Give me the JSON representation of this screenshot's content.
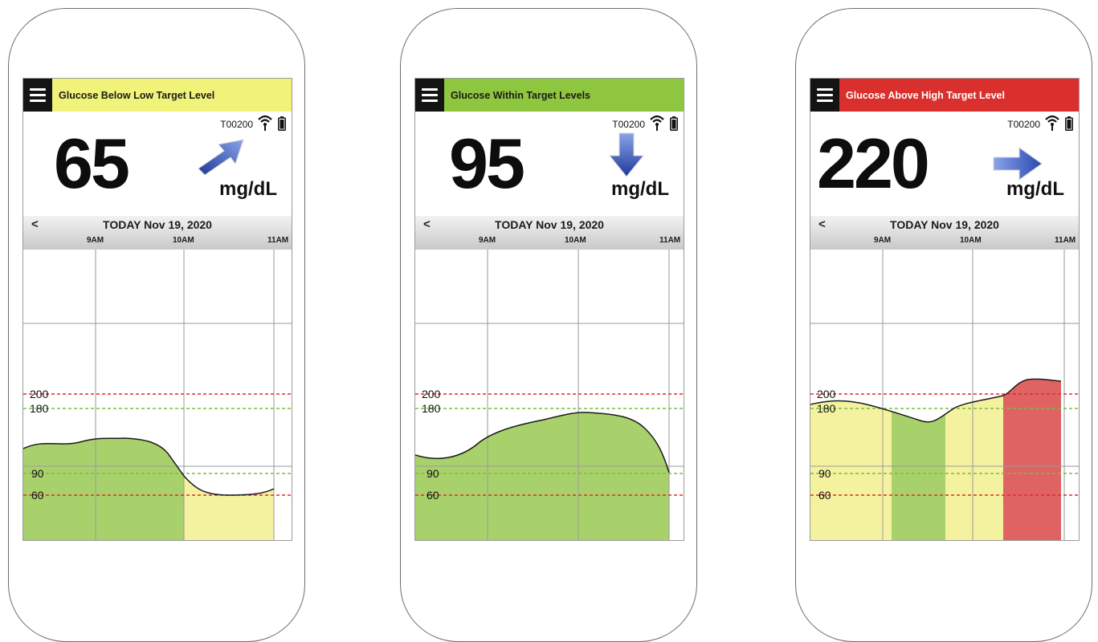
{
  "screens": [
    {
      "status_text": "Glucose Below Low Target Level",
      "status_color": "#f0f27a",
      "device_id": "T00200",
      "reading": "65",
      "unit": "mg/dL",
      "trend": "rising-arrow",
      "date": "TODAY Nov 19, 2020",
      "prev_label": "<",
      "times": [
        "9AM",
        "10AM",
        "11AM"
      ],
      "threshold_labels": [
        "200",
        "180",
        "90",
        "60"
      ]
    },
    {
      "status_text": "Glucose Within Target Levels",
      "status_color": "#8ec63f",
      "device_id": "T00200",
      "reading": "95",
      "unit": "mg/dL",
      "trend": "falling-arrow",
      "date": "TODAY Nov 19, 2020",
      "prev_label": "<",
      "times": [
        "9AM",
        "10AM",
        "11AM"
      ],
      "threshold_labels": [
        "200",
        "180",
        "90",
        "60"
      ]
    },
    {
      "status_text": "Glucose Above High Target Level",
      "status_color": "#d9302e",
      "device_id": "T00200",
      "reading": "220",
      "unit": "mg/dL",
      "trend": "steady-arrow",
      "date": "TODAY Nov 19, 2020",
      "prev_label": "<",
      "times": [
        "9AM",
        "10AM",
        "11AM"
      ],
      "threshold_labels": [
        "200",
        "180",
        "90",
        "60"
      ]
    }
  ],
  "colors": {
    "high_line": "#e02b2b",
    "target_line": "#77c043",
    "in_range_fill": "#a9d16b",
    "low_fill": "#f5f29f",
    "high_fill": "#e06363",
    "arrow": "#3c5cc0"
  }
}
